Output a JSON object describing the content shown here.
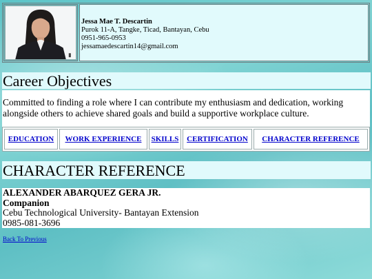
{
  "profile": {
    "name": "Jessa Mae T. Descartin",
    "address": "Purok 11-A, Tangke, Ticad, Bantayan, Cebu",
    "phone": "0951-965-0953",
    "email": "jessamaedescartin14@gmail.com"
  },
  "objectives": {
    "heading": "Career Objectives",
    "text": "Committed to finding a role where I can contribute my enthusiasm and dedication, working alongside others to achieve shared goals and build a supportive workplace culture."
  },
  "nav": {
    "items": [
      {
        "label": "EDUCATION"
      },
      {
        "label": "WORK EXPERIENCE"
      },
      {
        "label": "SKILLS"
      },
      {
        "label": "CERTIFICATION"
      },
      {
        "label": "CHARACTER REFERENCE"
      }
    ]
  },
  "reference": {
    "heading": "CHARACTER REFERENCE",
    "name": "ALEXANDER ABARQUEZ GERA JR.",
    "role": "Companion",
    "organization": "Cebu Technological University- Bantayan Extension",
    "phone": "0985-081-3696"
  },
  "back_link": "Back To Previous",
  "colors": {
    "panel": "#e1fafc",
    "link": "#0000cc",
    "background": "#5ec2c6"
  }
}
